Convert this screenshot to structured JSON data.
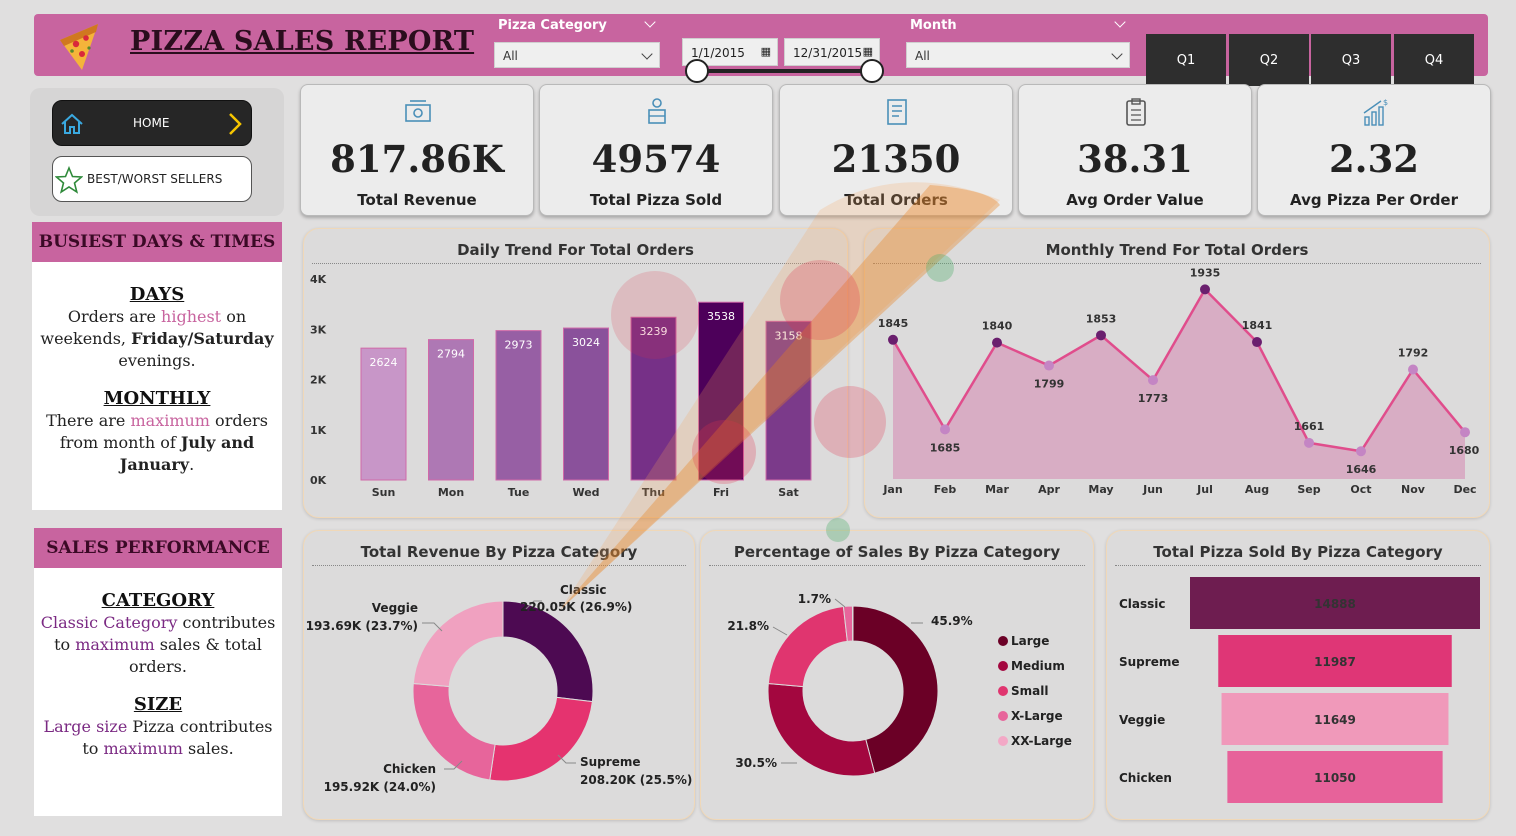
{
  "header": {
    "title": "PIZZA SALES REPORT",
    "category_label": "Pizza Category",
    "category_value": "All",
    "date_start": "1/1/2015",
    "date_end": "12/31/2015",
    "month_label": "Month",
    "month_value": "All",
    "quarters": [
      "Q1",
      "Q2",
      "Q3",
      "Q4"
    ]
  },
  "nav": {
    "home": "HOME",
    "best_worst": "BEST/WORST SELLERS"
  },
  "busiest": {
    "heading": "BUSIEST DAYS & TIMES",
    "days_title": "DAYS",
    "days_p1": "Orders are ",
    "days_hl": "highest",
    "days_p2": " on weekends, ",
    "days_bold": "Friday/Saturday",
    "days_p3": " evenings.",
    "monthly_title": "MONTHLY",
    "monthly_p1": "There are ",
    "monthly_hl": "maximum",
    "monthly_p2": " orders from month of ",
    "monthly_bold": "July and January",
    "monthly_p3": "."
  },
  "performance": {
    "heading": "SALES PERFORMANCE",
    "category_title": "CATEGORY",
    "cat_hl": "Classic Category",
    "cat_p1": " contributes to ",
    "cat_hl2": "maximum",
    "cat_p2": " sales & total orders.",
    "size_title": "SIZE",
    "size_hl": "Large size",
    "size_p1": " Pizza contributes to ",
    "size_hl2": "maximum",
    "size_p2": " sales."
  },
  "kpis": [
    {
      "value": "817.86K",
      "label": "Total Revenue",
      "icon": "money-icon"
    },
    {
      "value": "49574",
      "label": "Total Pizza Sold",
      "icon": "delivery-icon"
    },
    {
      "value": "21350",
      "label": "Total Orders",
      "icon": "orders-icon"
    },
    {
      "value": "38.31",
      "label": "Avg Order Value",
      "icon": "clipboard-icon"
    },
    {
      "value": "2.32",
      "label": "Avg Pizza Per Order",
      "icon": "growth-chart-icon"
    }
  ],
  "colors": {
    "accent": "#c8649f",
    "dark_purple": "#4a0a4f",
    "panel": "#dcdbdb"
  },
  "chart_data": [
    {
      "type": "bar",
      "title": "Daily Trend For Total Orders",
      "categories": [
        "Sun",
        "Mon",
        "Tue",
        "Wed",
        "Thu",
        "Fri",
        "Sat"
      ],
      "values": [
        2624,
        2794,
        2973,
        3024,
        3239,
        3538,
        3158
      ],
      "labels": [
        "2624",
        "2794",
        "2973",
        "3024",
        "3239",
        "3538",
        "3158"
      ],
      "colors": [
        "#c896c8",
        "#ae78b4",
        "#975fa4",
        "#8a519b",
        "#763087",
        "#4d005a",
        "#7b3a8a"
      ],
      "yticks": [
        "0K",
        "1K",
        "2K",
        "3K",
        "4K"
      ],
      "ylim": [
        0,
        4000
      ]
    },
    {
      "type": "line",
      "title": "Monthly Trend For Total Orders",
      "categories": [
        "Jan",
        "Feb",
        "Mar",
        "Apr",
        "May",
        "Jun",
        "Jul",
        "Aug",
        "Sep",
        "Oct",
        "Nov",
        "Dec"
      ],
      "values": [
        1845,
        1685,
        1840,
        1799,
        1853,
        1773,
        1935,
        1841,
        1661,
        1646,
        1792,
        1680
      ],
      "labels": [
        "1845",
        "1685",
        "1840",
        "1799",
        "1853",
        "1773",
        "1935",
        "1841",
        "1661",
        "1646",
        "1792",
        "1680"
      ]
    },
    {
      "type": "pie",
      "title": "Total Revenue By Pizza Category",
      "slices": [
        {
          "name": "Classic",
          "value": 26.9,
          "label": "220.05K (26.9%)",
          "color": "#4d0a52"
        },
        {
          "name": "Supreme",
          "value": 25.5,
          "label": "208.20K (25.5%)",
          "color": "#e5336f"
        },
        {
          "name": "Chicken",
          "value": 24.0,
          "label": "195.92K (24.0%)",
          "color": "#e7659b"
        },
        {
          "name": "Veggie",
          "value": 23.7,
          "label": "193.69K (23.7%)",
          "color": "#f0a1c0"
        }
      ]
    },
    {
      "type": "pie",
      "title": "Percentage of Sales By Pizza Category",
      "slices": [
        {
          "name": "Large",
          "value": 45.9,
          "label": "45.9%",
          "color": "#6b0026"
        },
        {
          "name": "Medium",
          "value": 30.5,
          "label": "30.5%",
          "color": "#a3073f"
        },
        {
          "name": "Small",
          "value": 21.8,
          "label": "21.8%",
          "color": "#e0356f"
        },
        {
          "name": "X-Large",
          "value": 1.7,
          "label": "1.7%",
          "color": "#e7659b"
        },
        {
          "name": "XX-Large",
          "value": 0.1,
          "label": "",
          "color": "#f3a8c6"
        }
      ]
    },
    {
      "type": "bar",
      "title": "Total Pizza Sold By Pizza Category",
      "categories": [
        "Classic",
        "Supreme",
        "Veggie",
        "Chicken"
      ],
      "values": [
        14888,
        11987,
        11649,
        11050
      ],
      "labels": [
        "14888",
        "11987",
        "11649",
        "11050"
      ],
      "colors": [
        "#6e1d50",
        "#df3676",
        "#f099ba",
        "#e7629a"
      ]
    }
  ]
}
